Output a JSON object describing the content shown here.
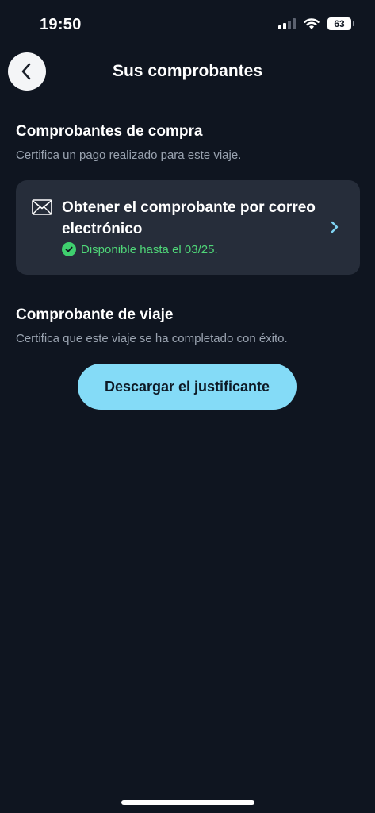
{
  "status_bar": {
    "time": "19:50",
    "battery": "63",
    "icons": [
      "signal-icon",
      "wifi-icon",
      "battery-icon"
    ]
  },
  "header": {
    "title": "Sus comprobantes",
    "back_icon": "chevron-left-icon"
  },
  "purchase_section": {
    "title": "Comprobantes de compra",
    "subtitle": "Certifica un pago realizado para este viaje.",
    "card": {
      "icon": "mail-icon",
      "title": "Obtener el comprobante por correo electrónico",
      "status": "Disponible hasta el 03/25.",
      "status_icon": "check-circle-icon",
      "chevron_icon": "chevron-right-icon"
    }
  },
  "trip_section": {
    "title": "Comprobante de viaje",
    "subtitle": "Certifica que este viaje se ha completado con éxito.",
    "button_label": "Descargar el justificante"
  },
  "colors": {
    "background": "#0f1520",
    "card": "#262d3a",
    "accent": "#84dbf7",
    "success": "#4fd678",
    "chevron": "#7fd3f2"
  }
}
